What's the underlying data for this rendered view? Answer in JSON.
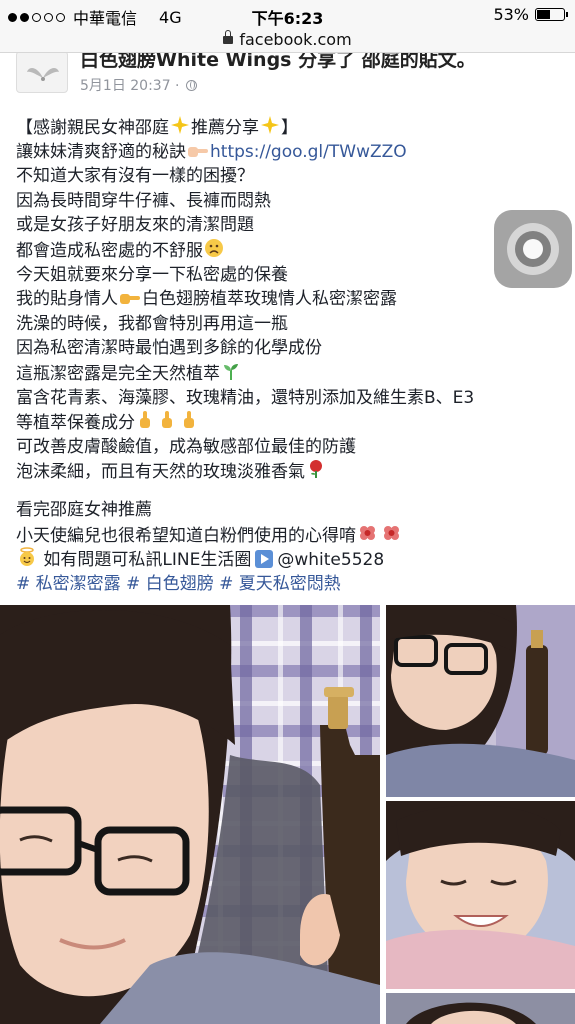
{
  "status_bar": {
    "carrier": "中華電信",
    "network": "4G",
    "time": "下午6:23",
    "battery": "53%",
    "battery_level": 0.53
  },
  "browser": {
    "url": "facebook.com"
  },
  "post": {
    "author_line": "白色翅膀White Wings 分享了 邵庭的貼文。",
    "date": "5月1日 20:37 ·",
    "lines": [
      "【感謝親民女神邵庭",
      "推薦分享",
      "】",
      "讓妹妹清爽舒適的秘訣",
      "https://goo.gl/TWwZZO",
      "不知道大家有沒有一樣的困擾？",
      "因為長時間穿牛仔褲、長褲而悶熱",
      "或是女孩子好朋友來的清潔問題",
      "都會造成私密處的不舒服",
      "今天姐就要來分享一下私密處的保養",
      "我的貼身情人",
      "白色翅膀植萃玫瑰情人私密潔密露",
      "洗澡的時候，我都會特別再用這一瓶",
      "因為私密清潔時最怕遇到多餘的化學成份",
      "這瓶潔密露是完全天然植萃",
      "富含花青素、海藻膠、玫瑰精油，還特別添加及維生素B、E3",
      "等植萃保養成分",
      "可改善皮膚酸鹼值，成為敏感部位最佳的防護",
      "泡沫柔細，而且有天然的玫瑰淡雅香氣",
      "看完邵庭女神推薦",
      "小天使編兒也很希望知道白粉們使用的心得唷",
      "如有問題可私訊LINE生活圈",
      "@white5528"
    ],
    "hashtags": "# 私密潔密露 # 白色翅膀 # 夏天私密悶熱"
  },
  "colors": {
    "link": "#365899",
    "meta": "#90949c"
  },
  "icons": [
    "lock-icon",
    "globe-icon",
    "sparkle-icon",
    "pointing-hand-icon",
    "worried-face-icon",
    "seedling-icon",
    "rose-icon",
    "flower-icon",
    "angel-icon",
    "play-icon",
    "assistive-touch-icon"
  ]
}
